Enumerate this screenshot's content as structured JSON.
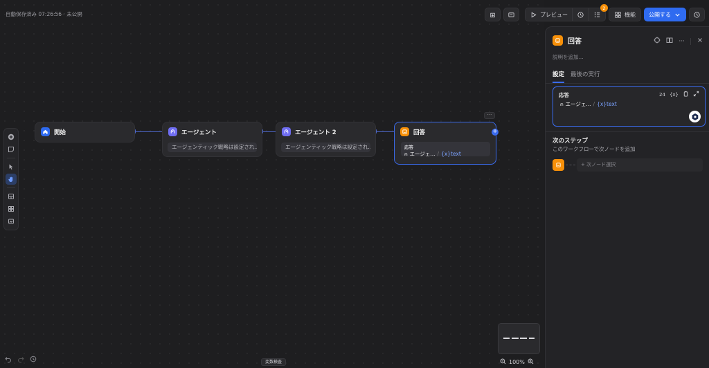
{
  "header": {
    "autosave": "自動保存済み 07:26:56 · 未公開",
    "preview_label": "プレビュー",
    "checklist_badge": "2",
    "features_label": "機能",
    "publish_label": "公開する"
  },
  "nodes": {
    "start": {
      "title": "開始"
    },
    "agent1": {
      "title": "エージェント",
      "strategy": "エージェンティック戦略は設定され..."
    },
    "agent2": {
      "title": "エージェント 2",
      "strategy": "エージェンティック戦略は設定され..."
    },
    "answer": {
      "title": "回答",
      "field_label": "応答",
      "ref_node": "エージェ...",
      "ref_var": "{x}text",
      "more": "···"
    }
  },
  "bottom": {
    "variable_check": "変数検査",
    "zoom": "100%"
  },
  "panel": {
    "title": "回答",
    "description_placeholder": "説明を追加...",
    "tabs": [
      "設定",
      "最後の実行"
    ],
    "response": {
      "label": "応答",
      "char_count": "24",
      "var_button": "{x}",
      "ref_node": "エージェ...",
      "ref_var": "{x}text"
    },
    "next_step": {
      "title": "次のステップ",
      "subtitle": "このワークフローで次ノードを追加",
      "select_placeholder": "+ 次ノード選択"
    }
  },
  "colors": {
    "accent": "#3b6cf0",
    "start_icon": "#2f6bf0",
    "agent_icon": "#6f6df1",
    "answer_icon": "#f79009",
    "badge": "#f79009"
  }
}
